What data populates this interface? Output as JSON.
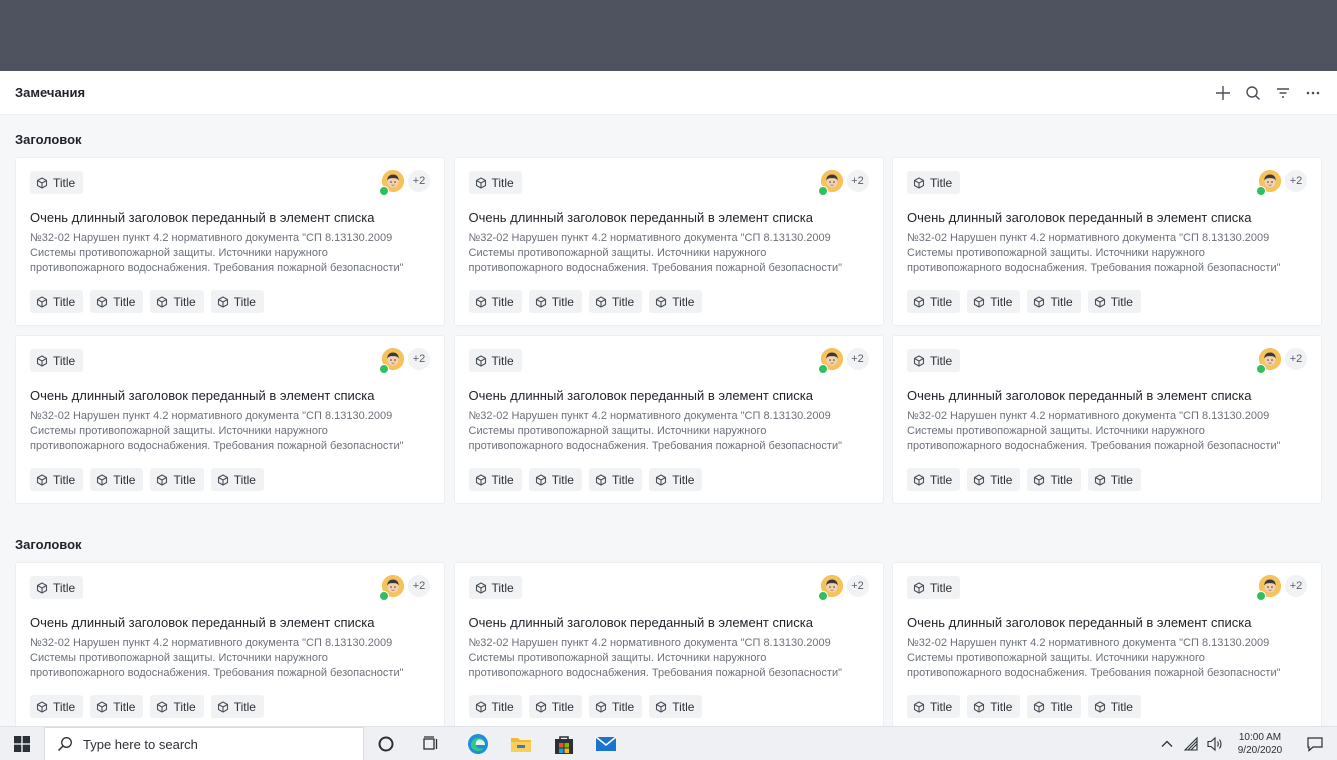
{
  "header": {
    "title": "Замечания"
  },
  "sections": [
    {
      "title": "Заголовок"
    },
    {
      "title": "Заголовок"
    }
  ],
  "card": {
    "chip_label": "Title",
    "assignee_more": "+2",
    "title": "Очень длинный заголовок переданный в элемент списка",
    "desc_line1": "№32-02 Нарушен пункт 4.2 нормативного документа \"СП 8.13130.2009",
    "desc_line2": "Системы противопожарной защиты. Источники наружного",
    "desc_line3": "противопожарного водоснабжения. Требования пожарной безопасности\"",
    "tags": [
      "Title",
      "Title",
      "Title",
      "Title"
    ]
  },
  "colors": {
    "topbar": "#4f535f",
    "status_ok": "#2fbf61",
    "avatar_bg": "#f6c25b"
  },
  "taskbar": {
    "search_placeholder": "Type here to search",
    "time": "10:00 AM",
    "date": "9/20/2020"
  }
}
